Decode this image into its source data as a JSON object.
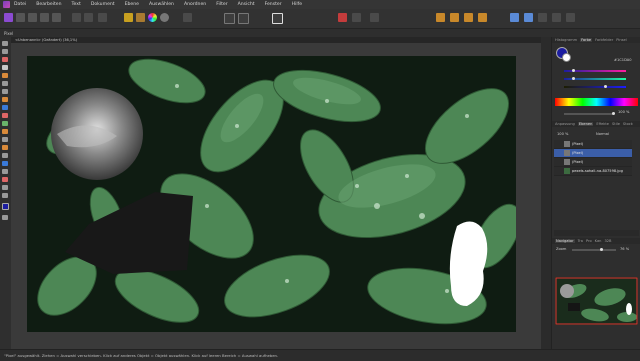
{
  "app": {
    "name": "Affinity Photo"
  },
  "menu": [
    "Datei",
    "Bearbeiten",
    "Text",
    "Dokument",
    "Ebene",
    "Auswählen",
    "Anordnen",
    "Filter",
    "Ansicht",
    "Fenster",
    "Hilfe"
  ],
  "context_label": "Pixel",
  "document_tab": "<Unbenannt> (Geändert) (36,1%)",
  "right_tabs_top": [
    "Histogramm",
    "Farbe",
    "Farbfelder",
    "Pinsel"
  ],
  "color": {
    "hex": "#1C1DA0",
    "opacity": "100 %"
  },
  "right_tabs_layers": [
    "Anpassung",
    "Ebenen",
    "Effekte",
    "Stile",
    "Stock"
  ],
  "layer_mode": "Normal",
  "layer_opacity": "100 %",
  "layers": [
    {
      "name": "(Pixel)",
      "selected": false
    },
    {
      "name": "(Pixel)",
      "selected": true
    },
    {
      "name": "(Pixel)",
      "selected": false
    },
    {
      "name": "pexels-sohail-na-807598.jpg",
      "selected": false
    }
  ],
  "nav_tabs": [
    "Navigator",
    "Tra",
    "Pro",
    "Kan",
    "32B"
  ],
  "zoom_label": "Zoom",
  "zoom_value": "76 %",
  "status": "\"Pixel\" ausgewählt. Ziehen = Auswahl verschieben. Klick auf anderes Objekt = Objekt auswählen. Klick auf leeren Bereich = Auswahl aufheben.",
  "colors": {
    "accent": "#3b5ea8",
    "leaf": "#4f8a57"
  }
}
